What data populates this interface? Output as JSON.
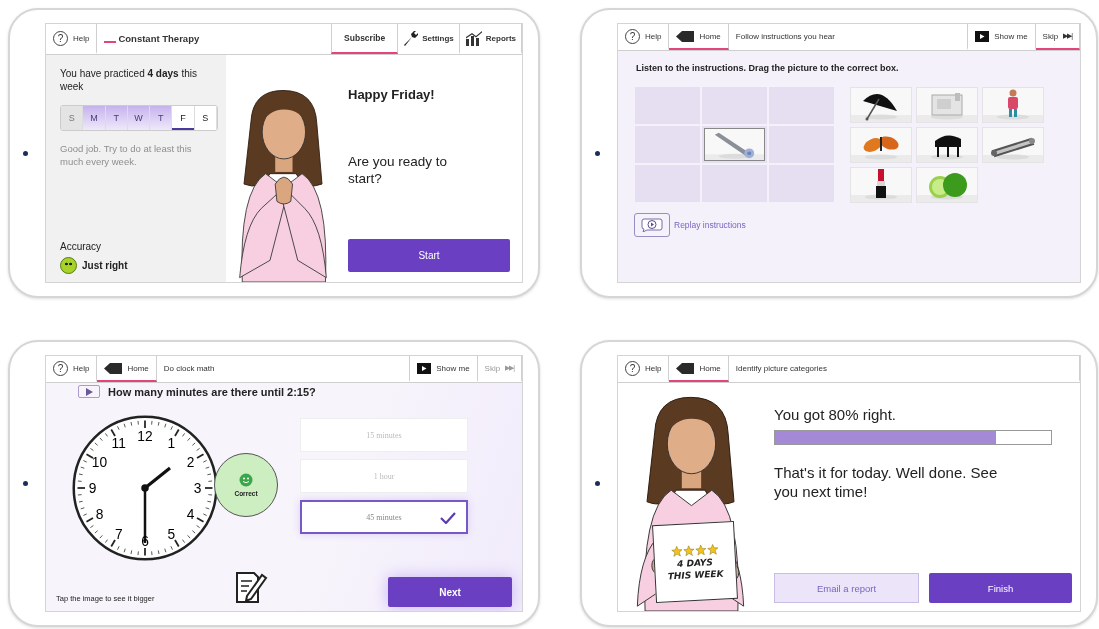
{
  "screens": [
    {
      "kind": "home",
      "toolbar": [
        {
          "kind": "help",
          "icon": "?",
          "label": "Help",
          "selected": false
        },
        {
          "kind": "brand",
          "label": "Constant Therapy"
        },
        {
          "kind": "subscribe",
          "label": "Subscribe",
          "selected": true
        },
        {
          "kind": "settings",
          "label": "Settings",
          "selected": false
        },
        {
          "kind": "reports",
          "label": "Reports",
          "selected": false
        }
      ],
      "practice_note": "You have practiced **4 days** this week",
      "days": [
        {
          "label": "S",
          "practiced": false,
          "today": false,
          "disabled": true
        },
        {
          "label": "M",
          "practiced": true,
          "today": false,
          "disabled": false
        },
        {
          "label": "T",
          "practiced": true,
          "today": false,
          "disabled": false
        },
        {
          "label": "W",
          "practiced": true,
          "today": false,
          "disabled": false
        },
        {
          "label": "T",
          "practiced": true,
          "today": false,
          "disabled": false
        },
        {
          "label": "F",
          "practiced": false,
          "today": true,
          "disabled": false
        },
        {
          "label": "S",
          "practiced": false,
          "today": false,
          "disabled": false
        }
      ],
      "encouragement": "Good job. Try to do at least this much every week.",
      "accuracy_label": "Accuracy",
      "accuracy_value": "Just right",
      "greeting": "Happy Friday!",
      "question": "Are you ready to start?",
      "start_button": "Start"
    },
    {
      "kind": "drag",
      "toolbar": [
        {
          "kind": "help",
          "icon": "?",
          "label": "Help",
          "selected": false
        },
        {
          "kind": "home",
          "label": "Home",
          "selected": true
        },
        {
          "kind": "task",
          "label": "Follow instructions you hear"
        },
        {
          "kind": "show_me",
          "label": "Show me",
          "selected": false
        },
        {
          "kind": "skip",
          "label": "Skip",
          "icon": "▶▶|",
          "selected": true,
          "disabled": false
        }
      ],
      "instruction": "Listen to the instructions. Drag the picture to the correct box.",
      "drop_slots": [
        {
          "filled": false
        },
        {
          "filled": false
        },
        {
          "filled": false
        },
        {
          "filled": false
        },
        {
          "filled": true
        },
        {
          "filled": false
        },
        {
          "filled": false
        },
        {
          "filled": false
        },
        {
          "filled": false
        }
      ],
      "replay": "Replay instructions"
    },
    {
      "kind": "choice",
      "toolbar": [
        {
          "kind": "help",
          "icon": "?",
          "label": "Help",
          "selected": false
        },
        {
          "kind": "home",
          "label": "Home",
          "selected": true
        },
        {
          "kind": "task",
          "label": "Do clock math"
        },
        {
          "kind": "show_me",
          "label": "Show me",
          "selected": false
        },
        {
          "kind": "skip",
          "label": "Skip",
          "icon": "▶▶|",
          "selected": false,
          "disabled": true
        }
      ],
      "question": "How many minutes are there until 2:15?",
      "clock_numerals": [
        "12",
        "1",
        "2",
        "3",
        "4",
        "5",
        "6",
        "7",
        "8",
        "9",
        "10",
        "11"
      ],
      "feedback": "Correct",
      "answers": [
        {
          "label": "15 minutes",
          "selected": false
        },
        {
          "label": "1 hour",
          "selected": false
        },
        {
          "label": "45 minutes",
          "selected": true
        }
      ],
      "hint": "Tap the image to see it bigger",
      "next_button": "Next"
    },
    {
      "kind": "result",
      "toolbar": [
        {
          "kind": "help",
          "icon": "?",
          "label": "Help",
          "selected": false
        },
        {
          "kind": "home",
          "label": "Home",
          "selected": true
        },
        {
          "kind": "task",
          "label": "Identify picture categories"
        }
      ],
      "score": "You got 80% right.",
      "level": 0.8,
      "message": "That's it for today. Well done. See you next time!",
      "sign": {
        "stars": 4,
        "lines": [
          "4 DAYS",
          "THIS WEEK"
        ]
      },
      "buttons": [
        {
          "kind": "secondary",
          "label": "Email a report"
        },
        {
          "kind": "primary",
          "label": "Finish"
        }
      ]
    }
  ]
}
